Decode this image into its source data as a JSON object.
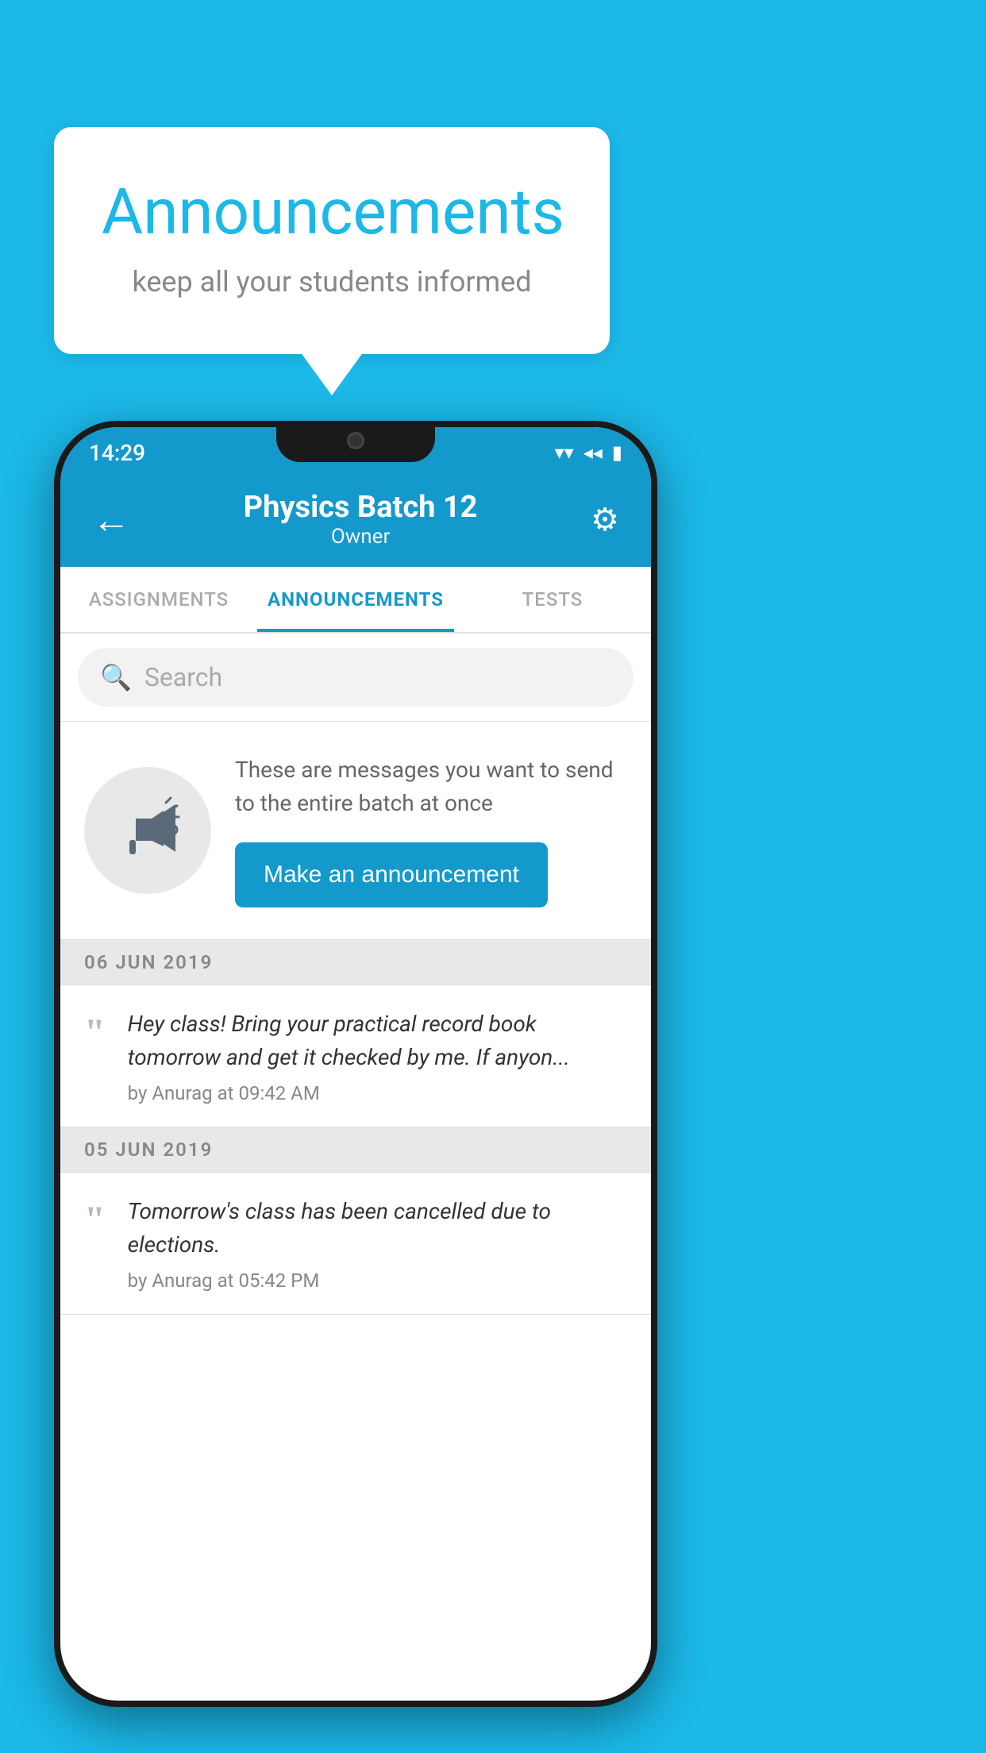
{
  "background_color": "#1bb8e8",
  "speech_bubble": {
    "title": "Announcements",
    "subtitle": "keep all your students informed"
  },
  "phone": {
    "status_bar": {
      "time": "14:29",
      "wifi": "▼",
      "signal": "◀",
      "battery": "▮"
    },
    "app_bar": {
      "back_label": "←",
      "title": "Physics Batch 12",
      "subtitle": "Owner",
      "settings_label": "⚙"
    },
    "tabs": [
      {
        "label": "ASSIGNMENTS",
        "active": false
      },
      {
        "label": "ANNOUNCEMENTS",
        "active": true
      },
      {
        "label": "TESTS",
        "active": false
      }
    ],
    "search": {
      "placeholder": "Search"
    },
    "intro": {
      "description": "These are messages you want to send to the entire batch at once",
      "button_label": "Make an announcement"
    },
    "announcement_groups": [
      {
        "date": "06  JUN  2019",
        "items": [
          {
            "message": "Hey class! Bring your practical record book tomorrow and get it checked by me. If anyon...",
            "author": "by Anurag at 09:42 AM"
          }
        ]
      },
      {
        "date": "05  JUN  2019",
        "items": [
          {
            "message": "Tomorrow's class has been cancelled due to elections.",
            "author": "by Anurag at 05:42 PM"
          }
        ]
      }
    ]
  }
}
